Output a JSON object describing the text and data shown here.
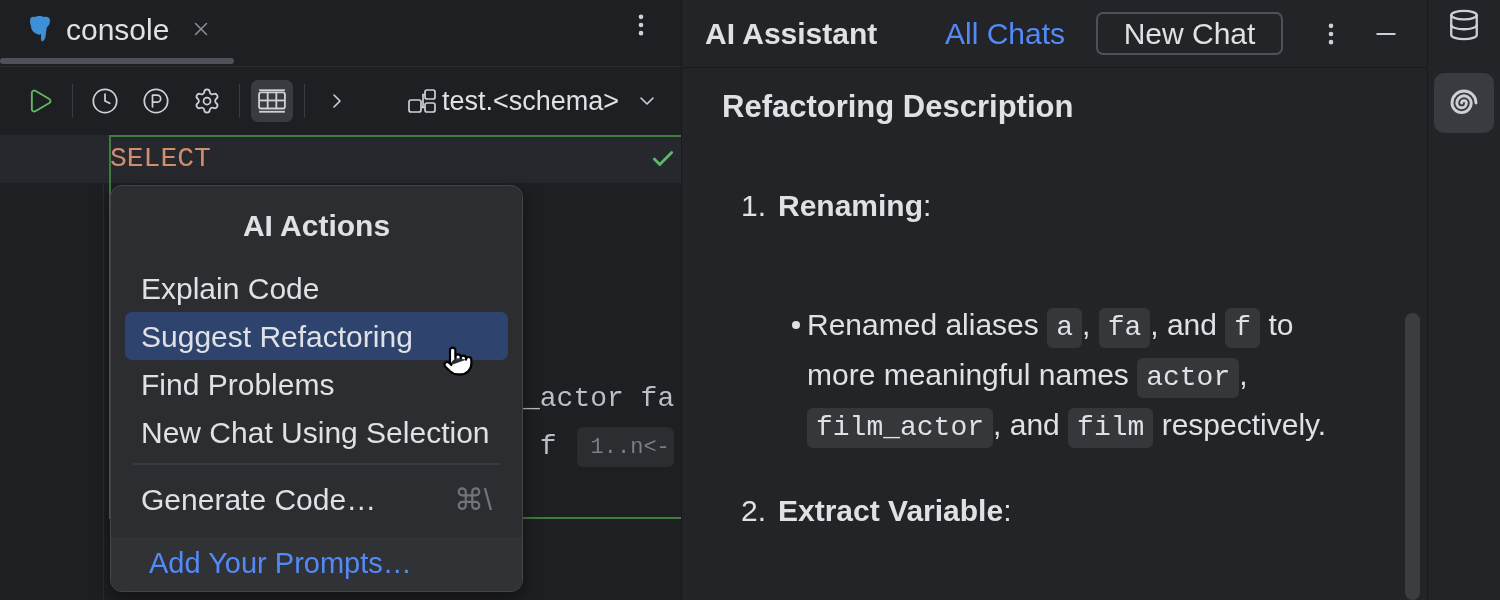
{
  "editor_tabs": [
    {
      "title": "console",
      "selected": true
    }
  ],
  "toolbar": {
    "groups": [
      {
        "buttons": [
          {
            "kind": "run",
            "selected": false
          }
        ]
      },
      {
        "buttons": [
          {
            "kind": "history",
            "selected": false
          },
          {
            "kind": "parameters",
            "selected": false
          },
          {
            "kind": "settings",
            "selected": false
          }
        ]
      },
      {
        "buttons": [
          {
            "kind": "table",
            "selected": true
          }
        ]
      },
      {
        "buttons": [
          {
            "kind": "more",
            "selected": false
          }
        ]
      }
    ],
    "schema": "test.<schema>"
  },
  "editor": {
    "lines": [
      {
        "text": "SELECT",
        "kind": "keyword",
        "current": true
      },
      {
        "text": "_actor fa",
        "kind": "plain",
        "current": false
      },
      {
        "text": " f",
        "kind": "plain",
        "current": false,
        "hint": "1..n<-"
      }
    ]
  },
  "ai_actions_menu": {
    "title": "AI Actions",
    "groups": [
      {
        "items": [
          {
            "label": "Explain Code",
            "selected": false
          },
          {
            "label": "Suggest Refactoring",
            "selected": true
          },
          {
            "label": "Find Problems",
            "selected": false
          },
          {
            "label": "New Chat Using Selection",
            "selected": false
          }
        ]
      },
      {
        "items": [
          {
            "label": "Generate Code…",
            "shortcut": "⌘\\",
            "selected": false
          }
        ]
      }
    ],
    "footer_link": "Add Your Prompts…"
  },
  "ai_panel": {
    "title": "AI Assistant",
    "all_chats": "All Chats",
    "new_chat": "New Chat",
    "heading": "Refactoring Description",
    "steps": [
      {
        "number": "1.",
        "title": "**Renaming**:",
        "bullets": [
          {
            "parts": [
              {
                "kind": "text",
                "text": "Renamed aliases "
              },
              {
                "kind": "code",
                "text": "a"
              },
              {
                "kind": "text",
                "text": ", "
              },
              {
                "kind": "code",
                "text": "fa"
              },
              {
                "kind": "text",
                "text": ", and "
              },
              {
                "kind": "code",
                "text": "f"
              },
              {
                "kind": "text",
                "text": " to more meaningful names "
              },
              {
                "kind": "code",
                "text": "actor"
              },
              {
                "kind": "text",
                "text": ", "
              },
              {
                "kind": "code",
                "text": "film_actor"
              },
              {
                "kind": "text",
                "text": ", and "
              },
              {
                "kind": "code",
                "text": "film"
              },
              {
                "kind": "text",
                "text": " respectively."
              }
            ]
          }
        ]
      },
      {
        "number": "2.",
        "title": "**Extract Variable**:"
      }
    ]
  },
  "tool_strip": [
    {
      "kind": "database",
      "selected": false
    },
    {
      "kind": "ai",
      "selected": true
    }
  ]
}
